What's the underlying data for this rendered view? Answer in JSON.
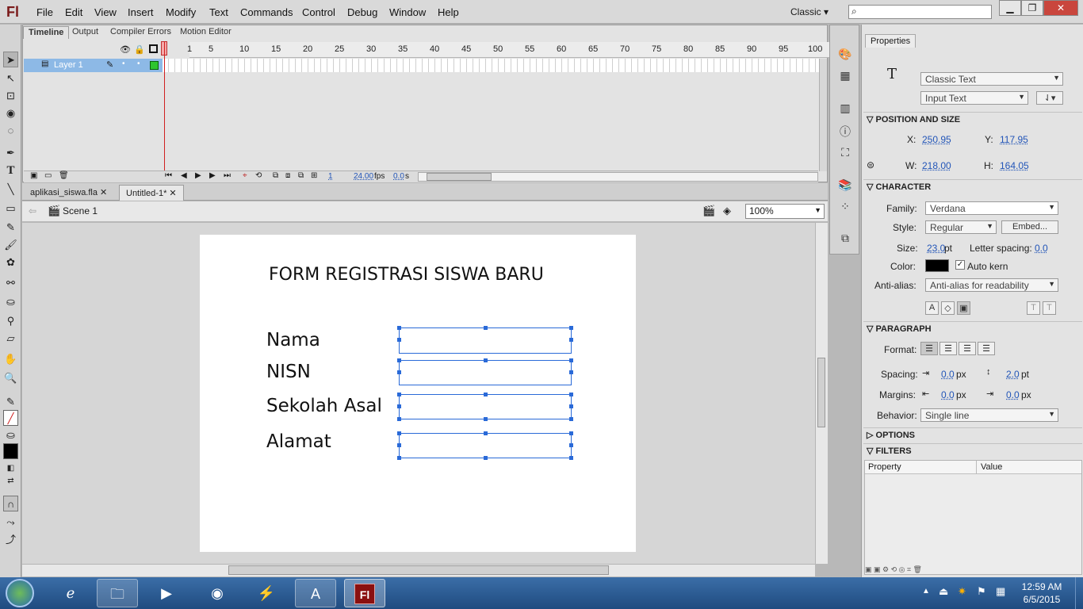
{
  "app": {
    "logo": "Fl"
  },
  "menu": [
    "File",
    "Edit",
    "View",
    "Insert",
    "Modify",
    "Text",
    "Commands",
    "Control",
    "Debug",
    "Window",
    "Help"
  ],
  "workspace": "Classic",
  "window_buttons": {
    "minimize": "▁",
    "restore": "❐",
    "close": "✕"
  },
  "timeline": {
    "tabs": [
      "Timeline",
      "Output",
      "Compiler Errors",
      "Motion Editor"
    ],
    "ruler": [
      "1",
      "5",
      "10",
      "15",
      "20",
      "25",
      "30",
      "35",
      "40",
      "45",
      "50",
      "55",
      "60",
      "65",
      "70",
      "75",
      "80",
      "85",
      "90",
      "95",
      "100"
    ],
    "layer_name": "Layer 1",
    "current_frame": "1",
    "fps": "24.00",
    "fps_unit": "fps",
    "time": "0.0",
    "time_unit": "s"
  },
  "document_tabs": [
    "aplikasi_siswa.fla",
    "Untitled-1*"
  ],
  "scene": {
    "name": "Scene 1",
    "zoom": "100%"
  },
  "stage": {
    "title": "FORM REGISTRASI SISWA BARU",
    "labels": [
      "Nama",
      "NISN",
      "Sekolah Asal",
      "Alamat"
    ]
  },
  "properties": {
    "tab": "Properties",
    "tool_icon": "T",
    "text_engine": "Classic Text",
    "text_type": "Input Text",
    "sections": {
      "position_size": "POSITION AND SIZE",
      "character": "CHARACTER",
      "paragraph": "PARAGRAPH",
      "options": "OPTIONS",
      "filters": "FILTERS"
    },
    "x_label": "X:",
    "x": "250.95",
    "y_label": "Y:",
    "y": "117.95",
    "w_label": "W:",
    "w": "218.00",
    "h_label": "H:",
    "h": "164.05",
    "family_label": "Family:",
    "family": "Verdana",
    "style_label": "Style:",
    "style": "Regular",
    "embed": "Embed...",
    "size_label": "Size:",
    "size": "23.0",
    "size_unit": "pt",
    "letter_spacing_label": "Letter spacing:",
    "letter_spacing": "0.0",
    "color_label": "Color:",
    "color": "#000000",
    "auto_kern": "Auto kern",
    "anti_alias_label": "Anti-alias:",
    "anti_alias": "Anti-alias for readability",
    "format_label": "Format:",
    "spacing_label": "Spacing:",
    "spacing_indent": "0.0",
    "spacing_indent_unit": "px",
    "line_spacing": "2.0",
    "line_spacing_unit": "pt",
    "margins_label": "Margins:",
    "margin_left": "0.0",
    "margin_left_unit": "px",
    "margin_right": "0.0",
    "margin_right_unit": "px",
    "behavior_label": "Behavior:",
    "behavior": "Single line",
    "filter_columns": [
      "Property",
      "Value"
    ]
  },
  "taskbar": {
    "time": "12:59 AM",
    "date": "6/5/2015"
  }
}
